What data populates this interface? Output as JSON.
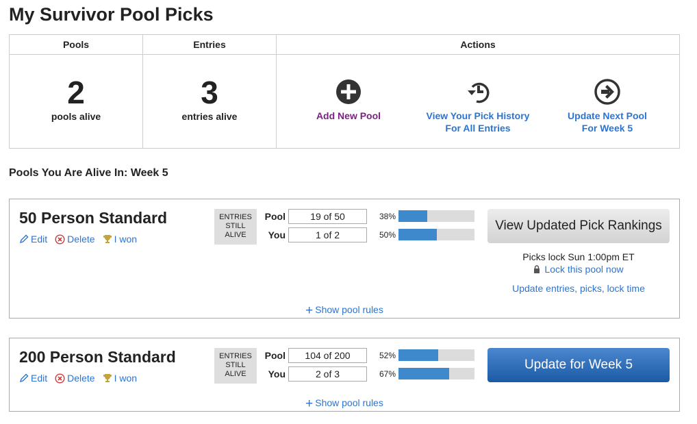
{
  "page": {
    "title": "My Survivor Pool Picks"
  },
  "summary": {
    "headers": {
      "pools": "Pools",
      "entries": "Entries",
      "actions": "Actions"
    },
    "pools_count": "2",
    "pools_label": "pools alive",
    "entries_count": "3",
    "entries_label": "entries alive",
    "actions": {
      "add_pool": {
        "label": "Add New Pool",
        "icon": "plus-circle-icon",
        "color": "#7d1f86"
      },
      "pick_history": {
        "line1": "View Your Pick History",
        "line2": "For All Entries",
        "icon": "history-icon"
      },
      "update_next": {
        "line1": "Update Next Pool",
        "line2": "For Week 5",
        "icon": "arrow-right-circle-icon"
      }
    }
  },
  "section": {
    "title": "Pools You Are Alive In: Week 5"
  },
  "pools": [
    {
      "name": "50 Person Standard",
      "links": {
        "edit": "Edit",
        "delete": "Delete",
        "won": "I won"
      },
      "badge": {
        "line1": "ENTRIES",
        "line2": "STILL",
        "line3": "ALIVE"
      },
      "pool_label": "Pool",
      "pool_value": "19 of 50",
      "pool_pct": "38%",
      "pool_fraction": 0.38,
      "you_label": "You",
      "you_value": "1 of 2",
      "you_pct": "50%",
      "you_fraction": 0.5,
      "button": "View Updated Pick Rankings",
      "lock_text": "Picks lock Sun 1:00pm ET",
      "lock_link": "Lock this pool now",
      "update_link": "Update entries, picks, lock time",
      "rules_link": "Show pool rules"
    },
    {
      "name": "200 Person Standard",
      "links": {
        "edit": "Edit",
        "delete": "Delete",
        "won": "I won"
      },
      "badge": {
        "line1": "ENTRIES",
        "line2": "STILL",
        "line3": "ALIVE"
      },
      "pool_label": "Pool",
      "pool_value": "104 of 200",
      "pool_pct": "52%",
      "pool_fraction": 0.52,
      "you_label": "You",
      "you_value": "2 of 3",
      "you_pct": "67%",
      "you_fraction": 0.67,
      "button": "Update for Week 5",
      "rules_link": "Show pool rules"
    }
  ],
  "colors": {
    "link": "#2b74d1",
    "add_pool": "#7d1f86",
    "bar_fill": "#3e88cc",
    "bar_track": "#dcdcdc",
    "delete_icon": "#d03a3a",
    "trophy_icon": "#c2a43a"
  }
}
